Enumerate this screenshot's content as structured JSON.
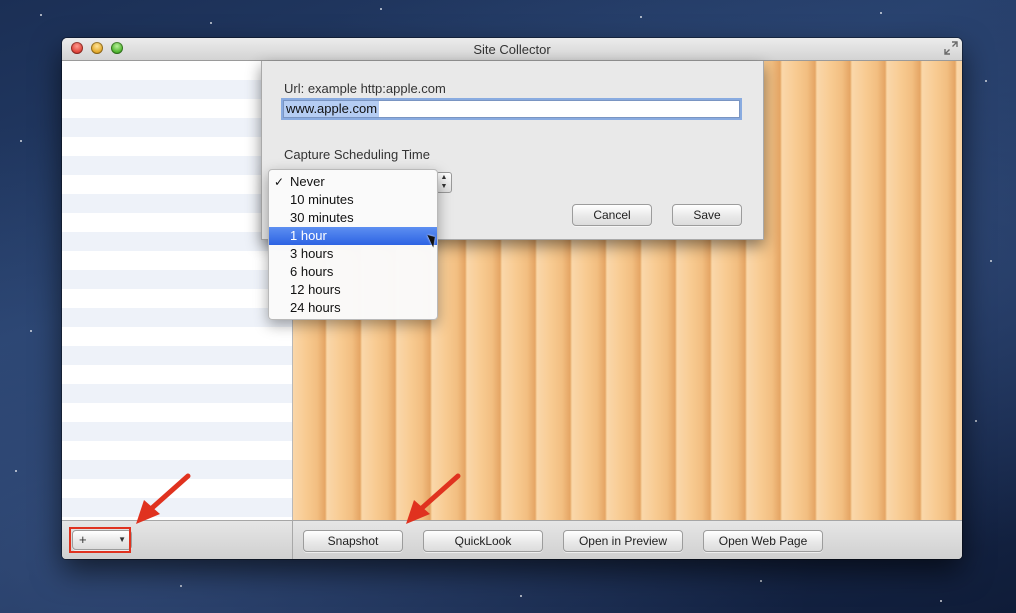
{
  "window": {
    "title": "Site Collector"
  },
  "sheet": {
    "url_label": "Url: example http:apple.com",
    "url_value": "www.apple.com",
    "schedule_label": "Capture Scheduling Time",
    "cancel_label": "Cancel",
    "save_label": "Save"
  },
  "schedule_menu": {
    "items": [
      "Never",
      "10 minutes",
      "30 minutes",
      "1 hour",
      "3 hours",
      "6 hours",
      "12 hours",
      "24 hours"
    ],
    "checked": "Never",
    "highlighted": "1 hour"
  },
  "bottom_bar": {
    "add_symbol": "+",
    "add_arrow": "▼",
    "snapshot_label": "Snapshot",
    "quicklook_label": "QuickLook",
    "open_preview_label": "Open in Preview",
    "open_web_label": "Open Web Page"
  },
  "icons": {
    "fullscreen": "fullscreen-icon",
    "check": "checkmark-icon",
    "annotation": "red-arrow-icon"
  },
  "colors": {
    "annotation_red": "#e0321f",
    "selection_blue": "#2d63e3",
    "wood": "#f8c98d"
  }
}
